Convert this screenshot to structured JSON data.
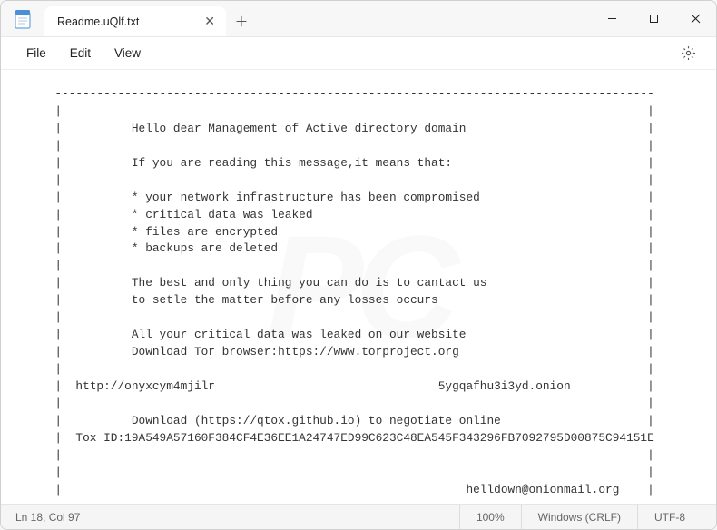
{
  "titlebar": {
    "tab_title": "Readme.uQlf.txt"
  },
  "menubar": {
    "file": "File",
    "edit": "Edit",
    "view": "View"
  },
  "content": {
    "lines": [
      "  --------------------------------------------------------------------------------------",
      "  |                                                                                    |",
      "  |          Hello dear Management of Active directory domain                          |",
      "  |                                                                                    |",
      "  |          If you are reading this message,it means that:                            |",
      "  |                                                                                    |",
      "  |          * your network infrastructure has been compromised                        |",
      "  |          * critical data was leaked                                                |",
      "  |          * files are encrypted                                                     |",
      "  |          * backups are deleted                                                     |",
      "  |                                                                                    |",
      "  |          The best and only thing you can do is to cantact us                       |",
      "  |          to setle the matter before any losses occurs                              |",
      "  |                                                                                    |",
      "  |          All your critical data was leaked on our website                          |",
      "  |          Download Tor browser:https://www.torproject.org                           |",
      "  |                                                                                    |",
      "  |  http://onyxcym4mjilr                                5ygqafhu3i3yd.onion           |",
      "  |                                                                                    |",
      "  |          Download (https://qtox.github.io) to negotiate online                     |",
      "  |  Tox ID:19A549A57160F384CF4E36EE1A24747ED99C623C48EA545F343296FB7092795D00875C94151E",
      "  |                                                                                    |",
      "  |                                                                                    |",
      "  |                                                          helldown@onionmail.org    |",
      "  --------------------------------------------------------------------------------------"
    ]
  },
  "statusbar": {
    "position": "Ln 18, Col 97",
    "zoom": "100%",
    "line_ending": "Windows (CRLF)",
    "encoding": "UTF-8"
  }
}
